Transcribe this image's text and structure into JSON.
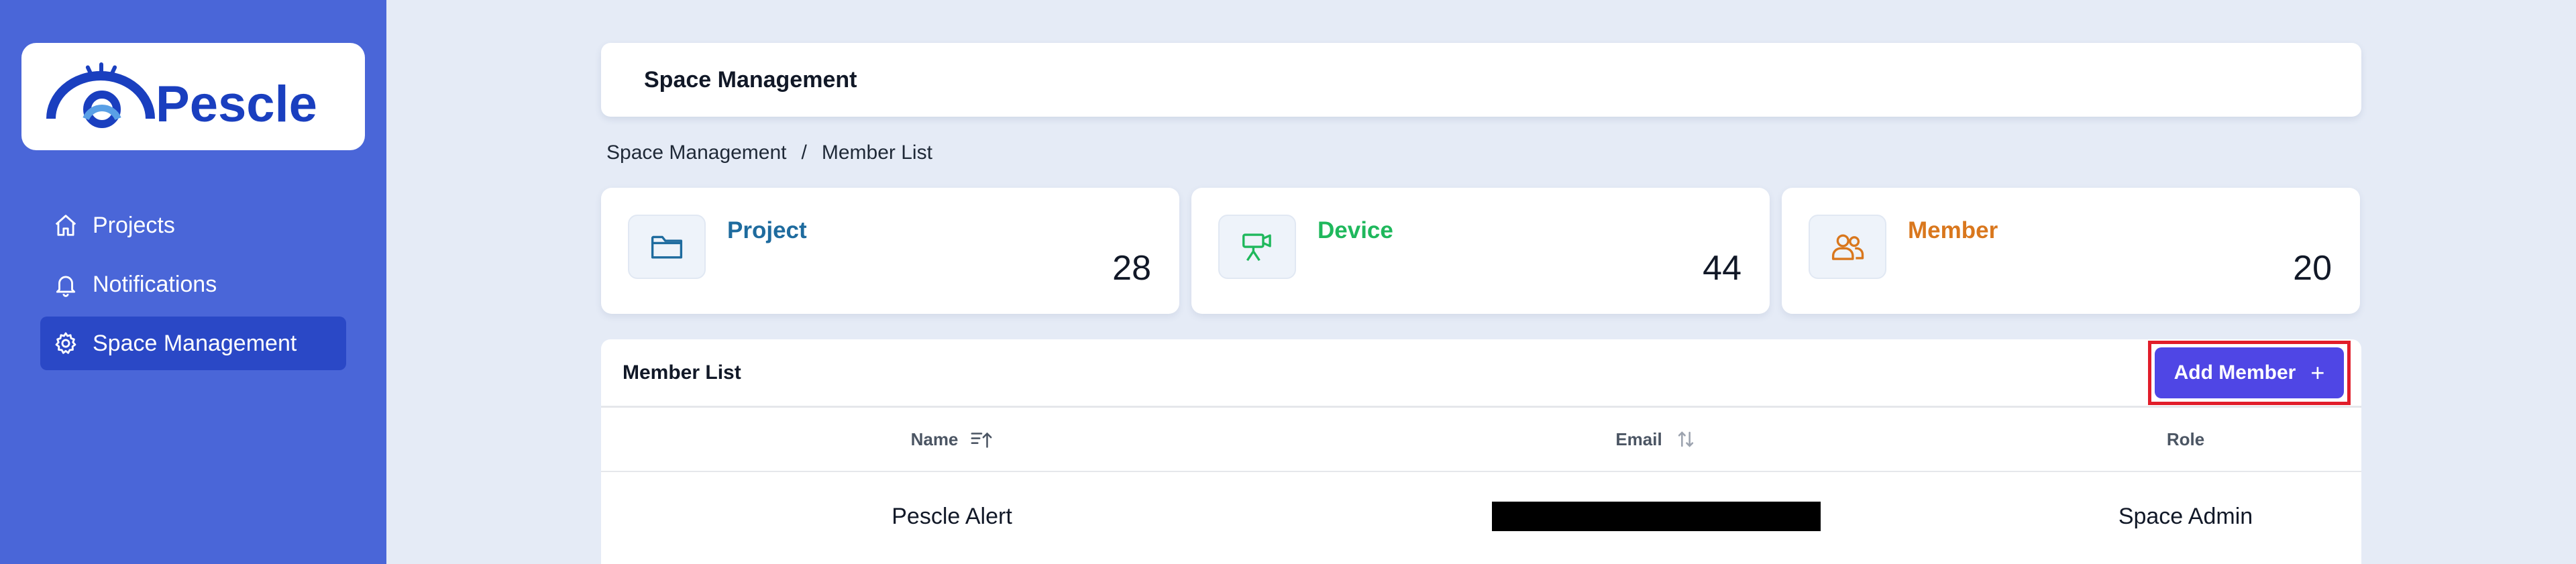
{
  "sidebar": {
    "logo_text": "Pescle",
    "items": [
      {
        "label": "Projects",
        "icon": "home-icon",
        "active": false
      },
      {
        "label": "Notifications",
        "icon": "bell-icon",
        "active": false
      },
      {
        "label": "Space Management",
        "icon": "gear-icon",
        "active": true
      }
    ]
  },
  "header": {
    "title": "Space Management"
  },
  "breadcrumb": {
    "items": [
      "Space Management",
      "Member List"
    ],
    "separator": "/"
  },
  "stats": [
    {
      "label": "Project",
      "value": "28",
      "icon": "folder-icon",
      "color": "#1e6b9e"
    },
    {
      "label": "Device",
      "value": "44",
      "icon": "camera-icon",
      "color": "#1fb85c"
    },
    {
      "label": "Member",
      "value": "20",
      "icon": "users-icon",
      "color": "#d9771d"
    }
  ],
  "member_list": {
    "title": "Member List",
    "add_button_label": "Add Member",
    "add_button_icon": "plus-icon",
    "columns": [
      {
        "label": "Name",
        "sort_icon": "sort-ascending-icon"
      },
      {
        "label": "Email",
        "sort_icon": "sort-icon"
      },
      {
        "label": "Role"
      }
    ],
    "rows": [
      {
        "name": "Pescle Alert",
        "email": "",
        "role": "Space Admin"
      }
    ]
  },
  "colors": {
    "sidebar_bg": "#4a66d8",
    "sidebar_active": "#2a48c6",
    "page_bg": "#e5ebf6",
    "primary_button": "#4f46e5",
    "highlight_border": "#e11d2a"
  }
}
